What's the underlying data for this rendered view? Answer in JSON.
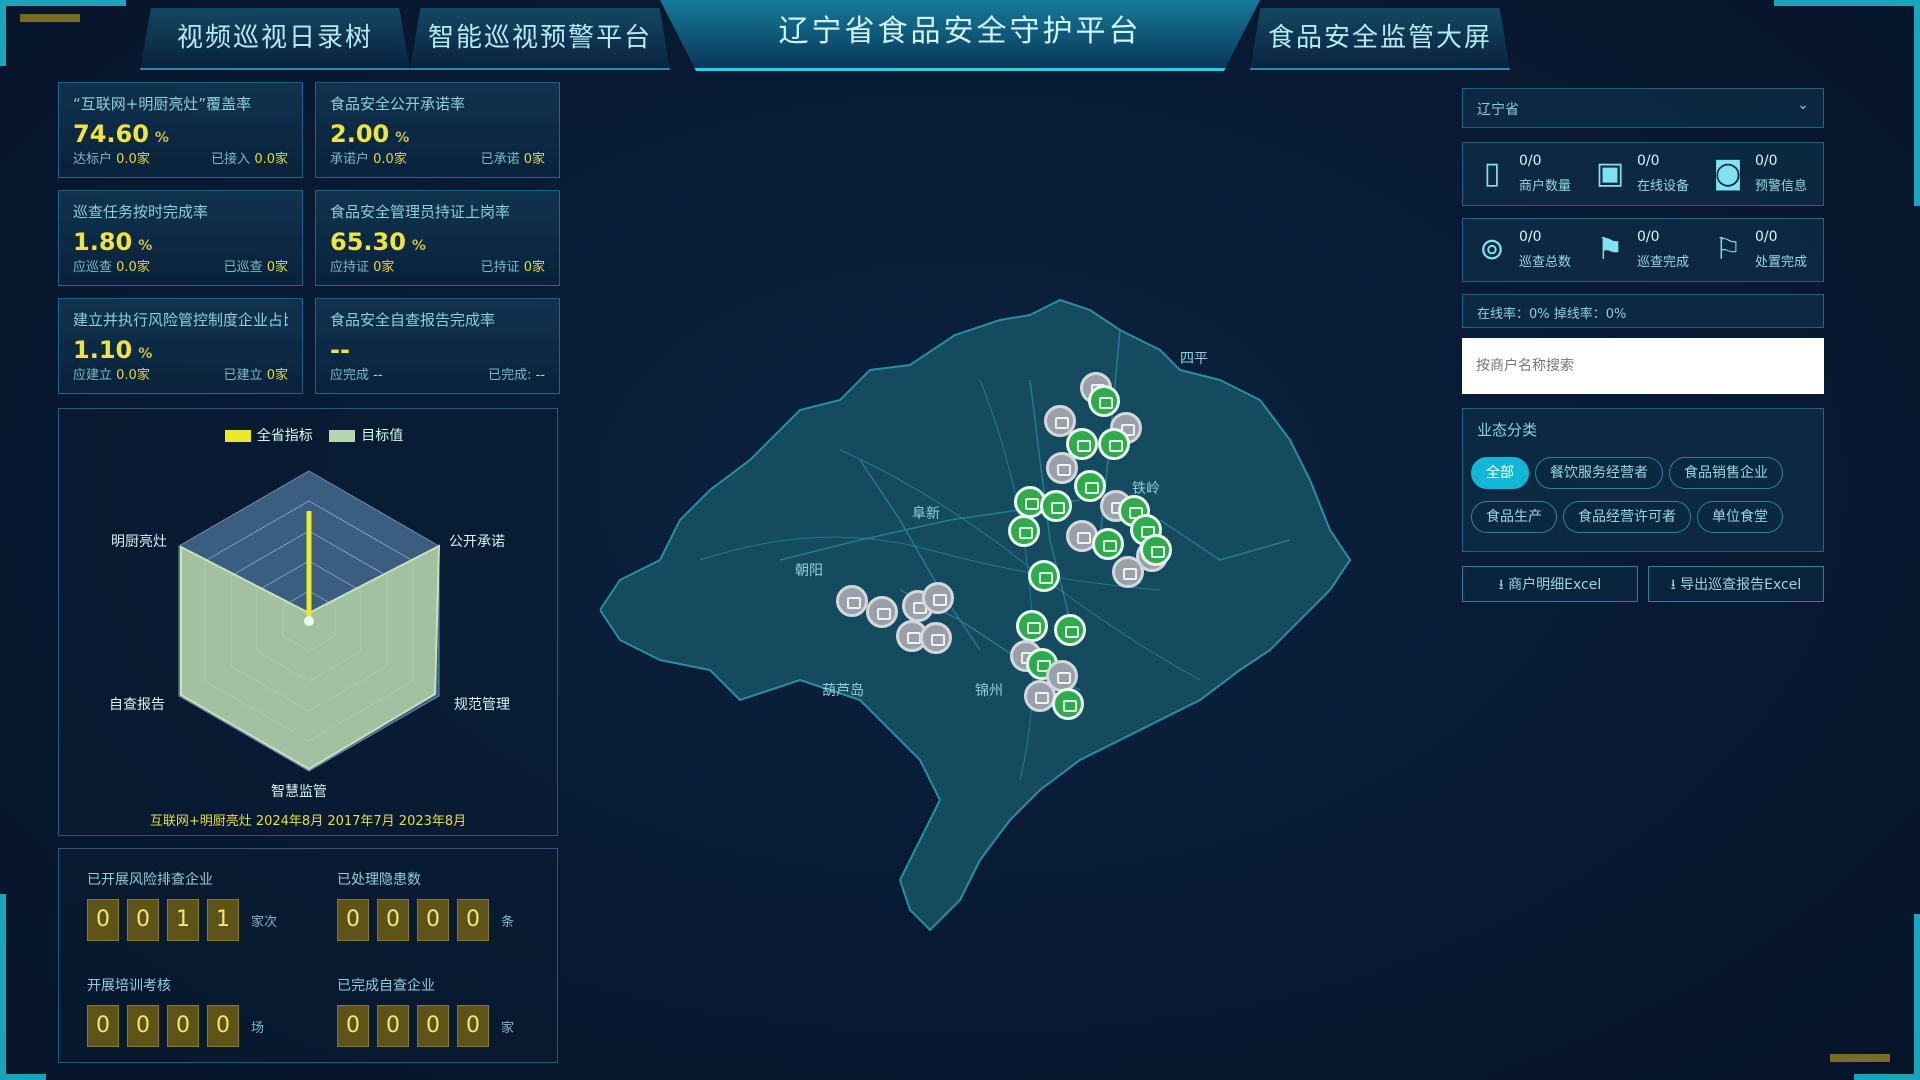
{
  "nav": {
    "tabs": [
      "视频巡视日录树",
      "智能巡视预警平台",
      "食品安全监管大屏"
    ],
    "title": "辽宁省食品安全守护平台"
  },
  "cards": [
    {
      "title": "“互联网+明厨亮灶”覆盖率",
      "value": "74.60",
      "unit": "%",
      "sub_left": "达标户",
      "sub_left_val": "0.0家",
      "sub_right": "已接入",
      "sub_right_val": "0.0家"
    },
    {
      "title": "食品安全公开承诺率",
      "value": "2.00",
      "unit": "%",
      "sub_left": "承诺户",
      "sub_left_val": "0.0家",
      "sub_right": "已承诺",
      "sub_right_val": "0家"
    },
    {
      "title": "巡查任务按时完成率",
      "value": "1.80",
      "unit": "%",
      "sub_left": "应巡查",
      "sub_left_val": "0.0家",
      "sub_right": "已巡查",
      "sub_right_val": "0家"
    },
    {
      "title": "食品安全管理员持证上岗率",
      "value": "65.30",
      "unit": "%",
      "sub_left": "应持证",
      "sub_left_val": "0家",
      "sub_right": "已持证",
      "sub_right_val": "0家"
    },
    {
      "title": "建立并执行风险管控制度企业占比",
      "value": "1.10",
      "unit": "%",
      "sub_left": "应建立",
      "sub_left_val": "0.0家",
      "sub_right": "已建立",
      "sub_right_val": "0家"
    },
    {
      "title": "食品安全自查报告完成率",
      "value": "--",
      "unit": "",
      "sub_left": "应完成",
      "sub_left_val": "--",
      "sub_right": "已完成:",
      "sub_right_val": "--"
    }
  ],
  "radar": {
    "legend": [
      {
        "name": "全省指标",
        "color": "#e8ea2a"
      },
      {
        "name": "目标值",
        "color": "#b6d6b0"
      }
    ],
    "labels": {
      "top": "",
      "right_top": "公开承诺",
      "right_bottom": "规范管理",
      "bottom": "智慧监管",
      "left_bottom": "自查报告",
      "left_top": "明厨亮灶"
    },
    "footer": "互联网+明厨亮灶 2024年8月 2017年7月 2023年8月"
  },
  "counters": [
    {
      "label": "已开展风险排查企业",
      "digits": [
        "0",
        "0",
        "1",
        "1"
      ],
      "unit": "家次"
    },
    {
      "label": "已处理隐患数",
      "digits": [
        "0",
        "0",
        "0",
        "0"
      ],
      "unit": "条"
    },
    {
      "label": "开展培训考核",
      "digits": [
        "0",
        "0",
        "0",
        "0"
      ],
      "unit": "场"
    },
    {
      "label": "已完成自查企业",
      "digits": [
        "0",
        "0",
        "0",
        "0"
      ],
      "unit": "家"
    }
  ],
  "map": {
    "labels": [
      "阜新",
      "朝阳",
      "葫芦岛",
      "锦州",
      "四平",
      "铁岭"
    ]
  },
  "right": {
    "region_select": "辽宁省",
    "stats": [
      {
        "icon": "document-icon",
        "num": "0/0",
        "text": "商户数量"
      },
      {
        "icon": "monitor-icon",
        "num": "0/0",
        "text": "在线设备"
      },
      {
        "icon": "chat-icon",
        "num": "0/0",
        "text": "预警信息"
      },
      {
        "icon": "location-icon",
        "num": "0/0",
        "text": "巡查总数"
      },
      {
        "icon": "flag-icon",
        "num": "0/0",
        "text": "巡查完成"
      },
      {
        "icon": "flag-alt-icon",
        "num": "0/0",
        "text": "处置完成"
      }
    ],
    "summary": "在线率：0% 掉线率：0%",
    "search_placeholder": "按商户名称搜索",
    "category_title": "业态分类",
    "chips": [
      "全部",
      "餐饮服务经营者",
      "食品销售企业",
      "食品生产",
      "食品经营许可者",
      "单位食堂"
    ],
    "active_chip": 0,
    "buttons": [
      "商户明细Excel",
      "导出巡查报告Excel"
    ]
  }
}
